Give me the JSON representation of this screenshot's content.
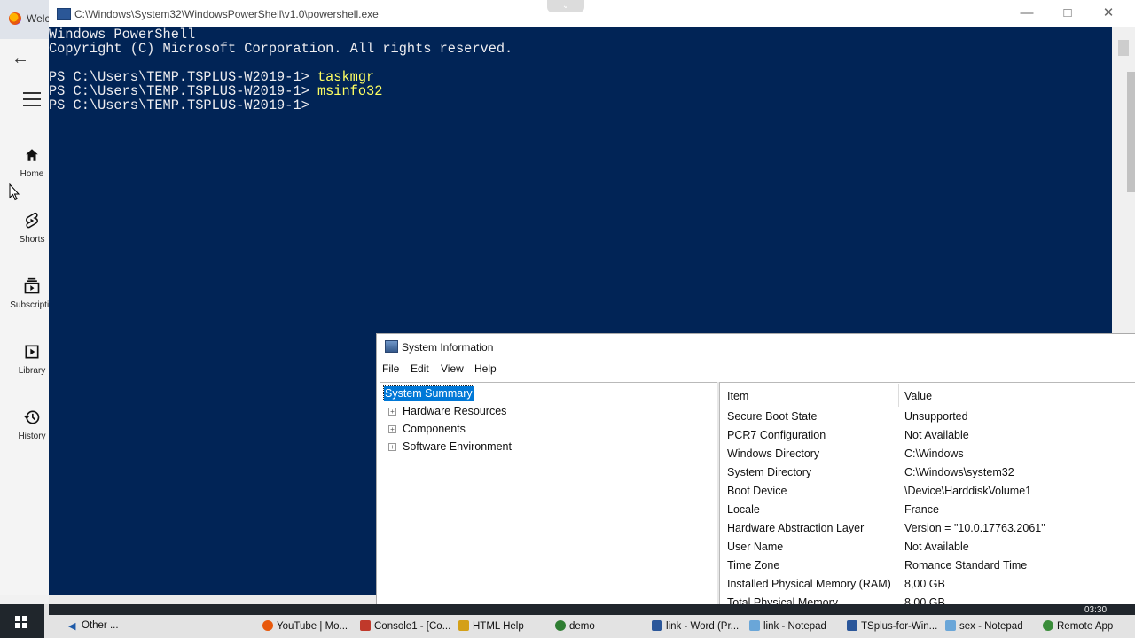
{
  "browser": {
    "tab_title": "Welc",
    "sidebar": [
      {
        "label": "Home",
        "icon": "home-icon"
      },
      {
        "label": "Shorts",
        "icon": "shorts-icon"
      },
      {
        "label": "Subscriptio",
        "icon": "subscriptions-icon"
      },
      {
        "label": "Library",
        "icon": "library-icon"
      },
      {
        "label": "History",
        "icon": "history-icon"
      }
    ]
  },
  "powershell": {
    "title": "C:\\Windows\\System32\\WindowsPowerShell\\v1.0\\powershell.exe",
    "lines": [
      {
        "prompt": "Windows PowerShell",
        "command": ""
      },
      {
        "prompt": "Copyright (C) Microsoft Corporation. All rights reserved.",
        "command": ""
      },
      {
        "prompt": "",
        "command": ""
      },
      {
        "prompt": "PS C:\\Users\\TEMP.TSPLUS-W2019-1> ",
        "command": "taskmgr"
      },
      {
        "prompt": "PS C:\\Users\\TEMP.TSPLUS-W2019-1> ",
        "command": "msinfo32"
      },
      {
        "prompt": "PS C:\\Users\\TEMP.TSPLUS-W2019-1> ",
        "command": ""
      }
    ],
    "colors": {
      "background": "#012456",
      "text": "#eeedf0",
      "command": "#ffff62"
    }
  },
  "sysinfo": {
    "title": "System Information",
    "menu": [
      "File",
      "Edit",
      "View",
      "Help"
    ],
    "tree": {
      "selected": "System Summary",
      "children": [
        "Hardware Resources",
        "Components",
        "Software Environment"
      ]
    },
    "columns": {
      "item": "Item",
      "value": "Value"
    },
    "rows": [
      {
        "item": "Secure Boot State",
        "value": "Unsupported"
      },
      {
        "item": "PCR7 Configuration",
        "value": "Not Available"
      },
      {
        "item": "Windows Directory",
        "value": "C:\\Windows"
      },
      {
        "item": "System Directory",
        "value": "C:\\Windows\\system32"
      },
      {
        "item": "Boot Device",
        "value": "\\Device\\HarddiskVolume1"
      },
      {
        "item": "Locale",
        "value": "France"
      },
      {
        "item": "Hardware Abstraction Layer",
        "value": "Version = \"10.0.17763.2061\""
      },
      {
        "item": "User Name",
        "value": "Not Available"
      },
      {
        "item": "Time Zone",
        "value": "Romance Standard Time"
      },
      {
        "item": "Installed Physical Memory (RAM)",
        "value": "8,00 GB"
      },
      {
        "item": "Total Physical Memory",
        "value": "8,00 GB"
      }
    ]
  },
  "taskbar": {
    "time": "03:30",
    "items": [
      {
        "label": "Other ...",
        "icon": "folder-icon",
        "color": "#1e5aa8"
      },
      {
        "label": "YouTube | Mo...",
        "icon": "firefox-icon",
        "color": "#e8590c"
      },
      {
        "label": "Console1 - [Co...",
        "icon": "mmc-icon",
        "color": "#c0392b"
      },
      {
        "label": "HTML Help",
        "icon": "help-icon",
        "color": "#d4a017"
      },
      {
        "label": "demo",
        "icon": "user-icon",
        "color": "#2e7d32"
      },
      {
        "label": "link - Word (Pr...",
        "icon": "word-icon",
        "color": "#2b579a"
      },
      {
        "label": "link - Notepad",
        "icon": "notepad-icon",
        "color": "#6aa6d8"
      },
      {
        "label": "TSplus-for-Win...",
        "icon": "word-icon",
        "color": "#2b579a"
      },
      {
        "label": "sex - Notepad",
        "icon": "notepad-icon",
        "color": "#6aa6d8"
      },
      {
        "label": "Remote App",
        "icon": "remote-app-icon",
        "color": "#3a8d3a"
      }
    ]
  }
}
